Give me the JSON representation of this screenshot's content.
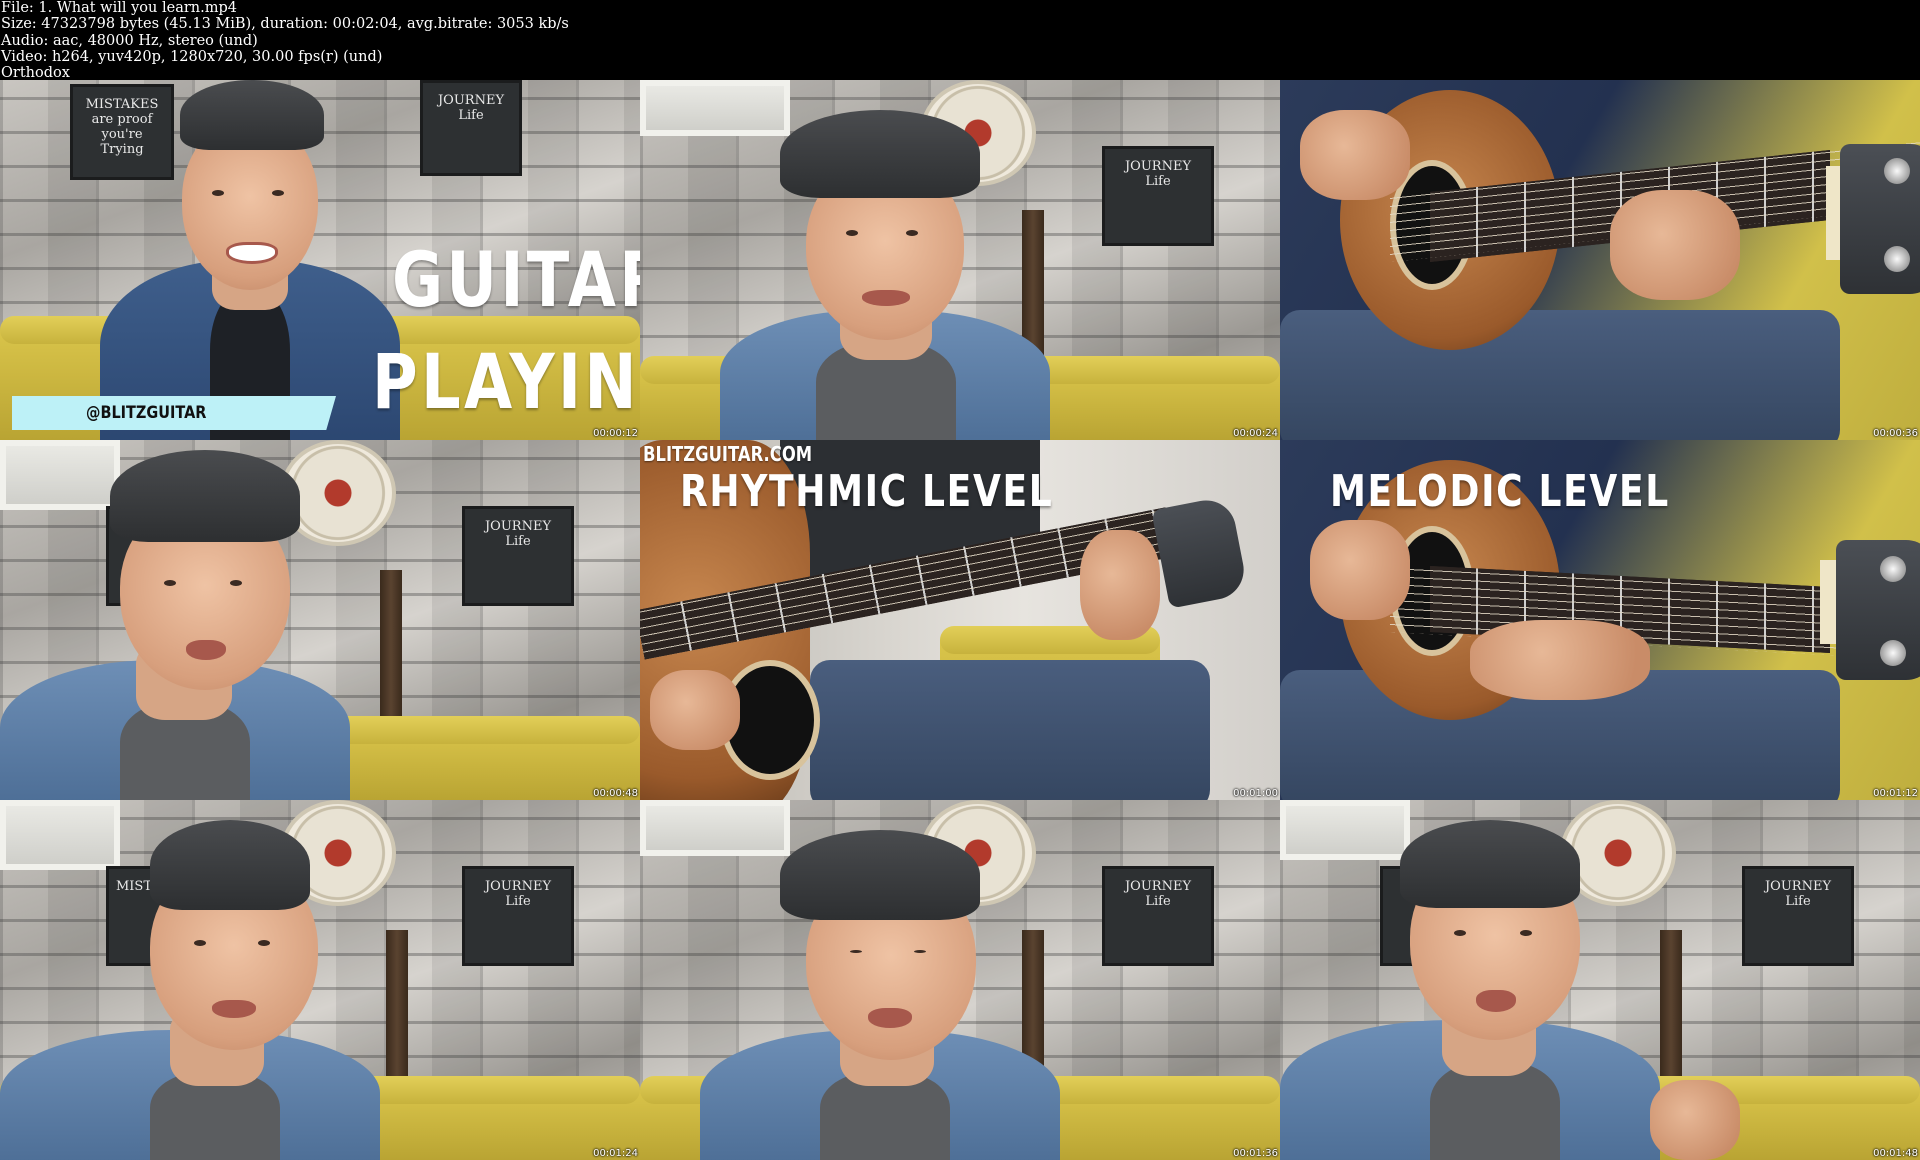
{
  "header": {
    "file_line": "File: 1. What will you learn.mp4",
    "size_line": "Size: 47323798 bytes (45.13 MiB), duration: 00:02:04, avg.bitrate: 3053 kb/s",
    "audio_line": "Audio: aac, 48000 Hz, stereo (und)",
    "video_line": "Video: h264, yuv420p, 1280x720, 30.00 fps(r) (und)",
    "tag_line": "Orthodox"
  },
  "frames": [
    {
      "timestamp": "00:00:12",
      "title_line1": "GUITAR",
      "title_line2": "PLAYING",
      "handle": "@BLITZGUITAR"
    },
    {
      "timestamp": "00:00:24"
    },
    {
      "timestamp": "00:00:36"
    },
    {
      "timestamp": "00:00:48"
    },
    {
      "timestamp": "00:01:00",
      "site": "BLITZGUITAR.COM",
      "title": "RHYTHMIC LEVEL"
    },
    {
      "timestamp": "00:01:12",
      "title": "MELODIC LEVEL"
    },
    {
      "timestamp": "00:01:24"
    },
    {
      "timestamp": "00:01:36"
    },
    {
      "timestamp": "00:01:48"
    }
  ],
  "colors": {
    "background": "#000000",
    "header_text": "#ffffff",
    "handle_bar": "#bdf1f7",
    "couch": "#d9c44a"
  }
}
